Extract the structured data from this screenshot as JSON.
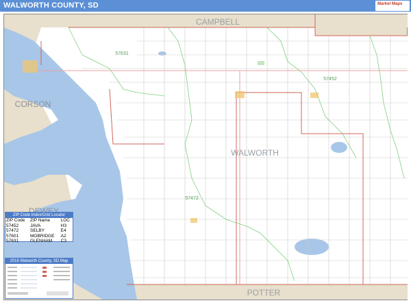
{
  "header": {
    "title": "WALWORTH COUNTY, SD",
    "logo_text": "Market Maps"
  },
  "map": {
    "county_label": "WALWORTH",
    "neighbor_labels": {
      "north": "CAMPBELL",
      "west": "CORSON",
      "southwest": "DEWEY",
      "south": "POTTER"
    },
    "zip_labels": [
      "57631",
      "57452",
      "57472"
    ],
    "colors": {
      "water": "#a8c6e8",
      "land_outside": "#e8dfcc",
      "county_fill": "#ffffff",
      "zip_boundary": "#7ed07e",
      "county_border": "#d0645a",
      "road": "#9a9a9a",
      "town": "#f0c66e"
    }
  },
  "zip_table": {
    "title": "ZIP Code Index/Grid Locator",
    "headers": [
      "ZIP Code",
      "ZIP Name",
      "LOC"
    ],
    "rows": [
      [
        "57452",
        "JAVA",
        "H3"
      ],
      [
        "57472",
        "SELBY",
        "E4"
      ],
      [
        "57601",
        "MOBRIDGE",
        "A2"
      ],
      [
        "57631",
        "GLENHAM",
        "C3"
      ]
    ]
  },
  "legend": {
    "title": "2016 Walworth County, SD Map"
  }
}
